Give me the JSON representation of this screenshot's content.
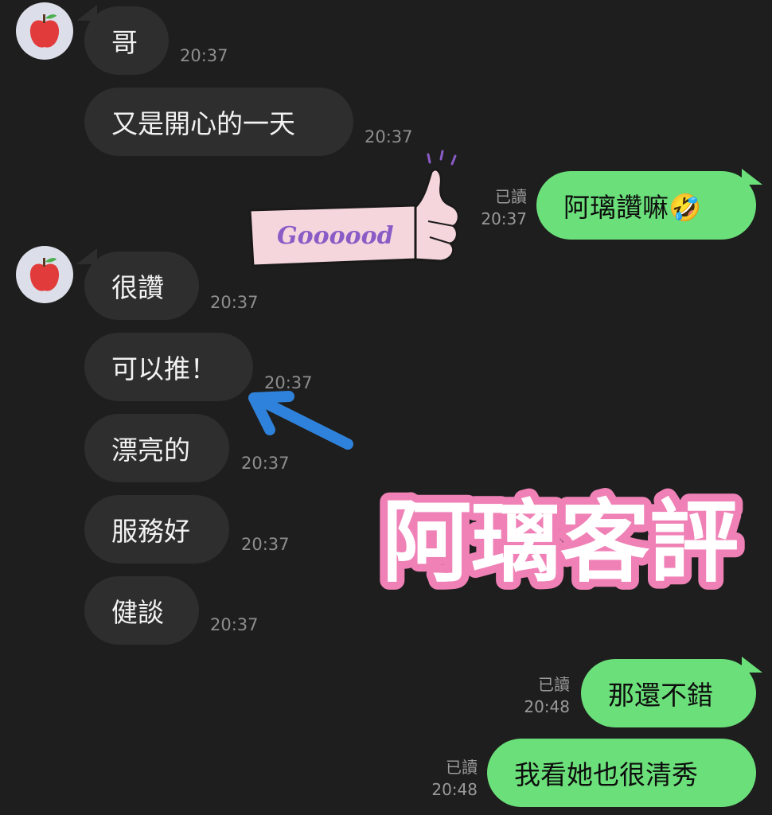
{
  "messages_in": [
    {
      "text": "哥",
      "time": "20:37"
    },
    {
      "text": "又是開心的一天",
      "time": "20:37"
    },
    {
      "text": "很讚",
      "time": "20:37"
    },
    {
      "text": "可以推！",
      "time": "20:37"
    },
    {
      "text": "漂亮的",
      "time": "20:37"
    },
    {
      "text": "服務好",
      "time": "20:37"
    },
    {
      "text": "健談",
      "time": "20:37"
    }
  ],
  "messages_out": [
    {
      "text": "阿璃讚嘛🤣",
      "read": "已讀",
      "time": "20:37"
    },
    {
      "text": "那還不錯",
      "read": "已讀",
      "time": "20:48"
    },
    {
      "text": "我看她也很清秀",
      "read": "已讀",
      "time": "20:48"
    }
  ],
  "overlay": {
    "sticker_text": "Goooood",
    "banner_text": "阿璃客評"
  },
  "colors": {
    "background": "#1e1e1e",
    "incoming_bubble": "#2e2e2e",
    "outgoing_bubble": "#6be07a",
    "banner_pink": "#f081b6",
    "arrow_blue": "#2f82db"
  },
  "icons": {
    "avatar": "apple-icon",
    "emoji": "rofl-emoji",
    "arrow": "arrow-icon"
  }
}
